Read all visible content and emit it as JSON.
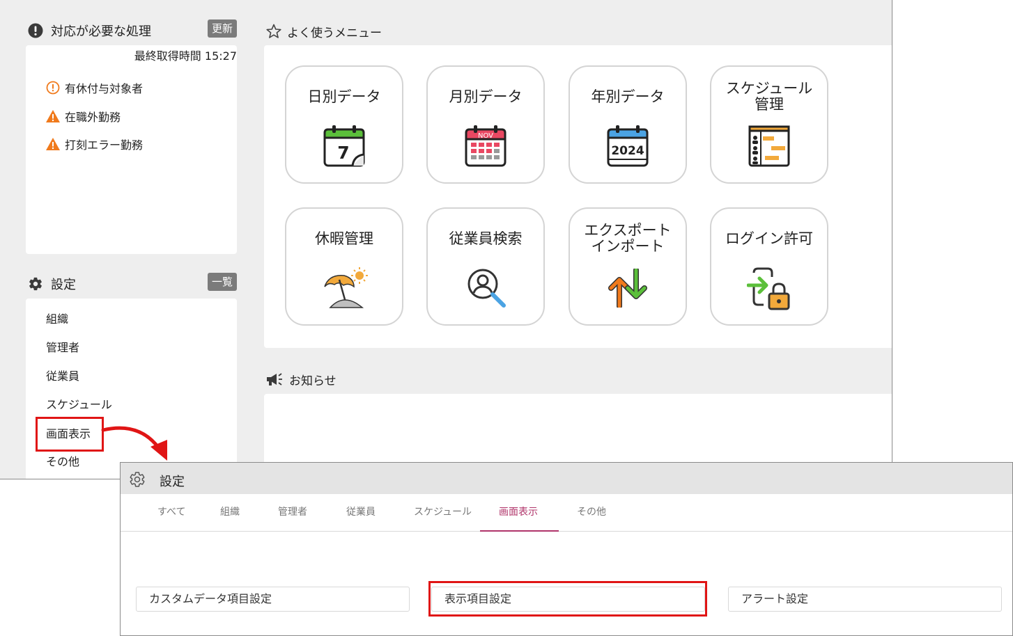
{
  "attention": {
    "title": "対応が必要な処理",
    "refresh_label": "更新",
    "last_fetched": "最終取得時間 15:27",
    "items": [
      {
        "label": "有休付与対象者",
        "icon": "info-circle-orange-icon"
      },
      {
        "label": "在職外勤務",
        "icon": "warning-triangle-icon"
      },
      {
        "label": "打刻エラー勤務",
        "icon": "warning-triangle-icon"
      }
    ]
  },
  "settings_panel": {
    "title": "設定",
    "list_label": "一覧",
    "items": [
      "組織",
      "管理者",
      "従業員",
      "スケジュール",
      "画面表示",
      "その他"
    ]
  },
  "favorites": {
    "title": "よく使うメニュー",
    "tiles": [
      {
        "label": "日別データ",
        "icon": "daily-calendar-icon",
        "icon_text": "7"
      },
      {
        "label": "月別データ",
        "icon": "monthly-calendar-icon",
        "icon_text": "NOV"
      },
      {
        "label": "年別データ",
        "icon": "yearly-calendar-icon",
        "icon_text": "2024"
      },
      {
        "label": "スケジュール\n管理",
        "icon": "schedule-chart-icon"
      },
      {
        "label": "休暇管理",
        "icon": "beach-umbrella-icon"
      },
      {
        "label": "従業員検索",
        "icon": "employee-search-icon"
      },
      {
        "label": "エクスポート\nインポート",
        "icon": "export-import-arrows-icon"
      },
      {
        "label": "ログイン許可",
        "icon": "login-lock-icon"
      }
    ]
  },
  "news": {
    "title": "お知らせ"
  },
  "settings_window": {
    "title": "設定",
    "tabs": [
      "すべて",
      "組織",
      "管理者",
      "従業員",
      "スケジュール",
      "画面表示",
      "その他"
    ],
    "active_tab": "画面表示",
    "buttons": [
      "カスタムデータ項目設定",
      "表示項目設定",
      "アラート設定"
    ]
  },
  "colors": {
    "accent_tab": "#b0346a",
    "highlight_red": "#e01515",
    "warning_orange": "#f07a1c"
  }
}
